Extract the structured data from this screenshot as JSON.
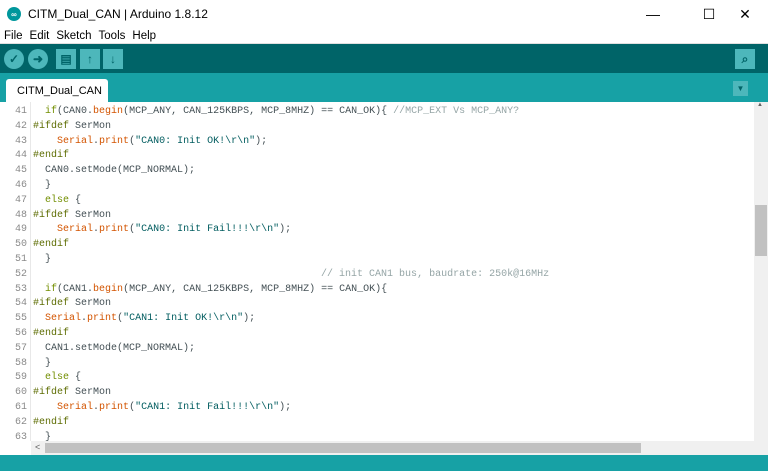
{
  "window": {
    "title": "CITM_Dual_CAN | Arduino 1.8.12",
    "minimize": "—",
    "maximize": "☐",
    "close": "✕"
  },
  "menu": [
    "File",
    "Edit",
    "Sketch",
    "Tools",
    "Help"
  ],
  "toolbar": {
    "verify": "✓",
    "upload": "➜",
    "new": "▤",
    "open": "↑",
    "save": "↓",
    "serial_monitor": "⌕"
  },
  "tabs": {
    "active": "CITM_Dual_CAN",
    "menu": "▼"
  },
  "colors": {
    "toolbar": "#006468",
    "tabbar": "#17A1A5",
    "keyword": "#728E00",
    "preprocessor": "#5E6D03",
    "function": "#D35400",
    "comment": "#95A5A6"
  },
  "code": [
    {
      "n": "41",
      "t": [
        [
          "n",
          "  "
        ],
        [
          "k",
          "if"
        ],
        [
          "n",
          "(CAN0."
        ],
        [
          "f",
          "begin"
        ],
        [
          "n",
          "(MCP_ANY, CAN_125KBPS, MCP_8MHZ) == CAN_OK){ "
        ],
        [
          "c",
          "//MCP_EXT Vs MCP_ANY?"
        ]
      ]
    },
    {
      "n": "42",
      "t": [
        [
          "p",
          "#ifdef"
        ],
        [
          "n",
          " SerMon"
        ]
      ]
    },
    {
      "n": "43",
      "t": [
        [
          "n",
          "    "
        ],
        [
          "f",
          "Serial"
        ],
        [
          "n",
          "."
        ],
        [
          "f",
          "print"
        ],
        [
          "n",
          "("
        ],
        [
          "s",
          "\"CAN0: Init OK!\\r\\n\""
        ],
        [
          "n",
          ");"
        ]
      ]
    },
    {
      "n": "44",
      "t": [
        [
          "p",
          "#endif"
        ]
      ]
    },
    {
      "n": "45",
      "t": [
        [
          "n",
          "  CAN0.setMode(MCP_NORMAL);"
        ]
      ]
    },
    {
      "n": "46",
      "t": [
        [
          "n",
          "  }"
        ]
      ]
    },
    {
      "n": "47",
      "t": [
        [
          "n",
          "  "
        ],
        [
          "k",
          "else"
        ],
        [
          "n",
          " {"
        ]
      ]
    },
    {
      "n": "48",
      "t": [
        [
          "p",
          "#ifdef"
        ],
        [
          "n",
          " SerMon"
        ]
      ]
    },
    {
      "n": "49",
      "t": [
        [
          "n",
          "    "
        ],
        [
          "f",
          "Serial"
        ],
        [
          "n",
          "."
        ],
        [
          "f",
          "print"
        ],
        [
          "n",
          "("
        ],
        [
          "s",
          "\"CAN0: Init Fail!!!\\r\\n\""
        ],
        [
          "n",
          ");"
        ]
      ]
    },
    {
      "n": "50",
      "t": [
        [
          "p",
          "#endif"
        ]
      ]
    },
    {
      "n": "51",
      "t": [
        [
          "n",
          "  }"
        ]
      ]
    },
    {
      "n": "52",
      "t": [
        [
          "n",
          "                                                "
        ],
        [
          "c",
          "// init CAN1 bus, baudrate: 250k@16MHz"
        ]
      ]
    },
    {
      "n": "53",
      "t": [
        [
          "n",
          "  "
        ],
        [
          "k",
          "if"
        ],
        [
          "n",
          "(CAN1."
        ],
        [
          "f",
          "begin"
        ],
        [
          "n",
          "(MCP_ANY, CAN_125KBPS, MCP_8MHZ) == CAN_OK){"
        ]
      ]
    },
    {
      "n": "54",
      "t": [
        [
          "p",
          "#ifdef"
        ],
        [
          "n",
          " SerMon"
        ]
      ]
    },
    {
      "n": "55",
      "t": [
        [
          "n",
          "  "
        ],
        [
          "f",
          "Serial"
        ],
        [
          "n",
          "."
        ],
        [
          "f",
          "print"
        ],
        [
          "n",
          "("
        ],
        [
          "s",
          "\"CAN1: Init OK!\\r\\n\""
        ],
        [
          "n",
          ");"
        ]
      ]
    },
    {
      "n": "56",
      "t": [
        [
          "p",
          "#endif"
        ]
      ]
    },
    {
      "n": "57",
      "t": [
        [
          "n",
          "  CAN1.setMode(MCP_NORMAL);"
        ]
      ]
    },
    {
      "n": "58",
      "t": [
        [
          "n",
          "  }"
        ]
      ]
    },
    {
      "n": "59",
      "t": [
        [
          "n",
          "  "
        ],
        [
          "k",
          "else"
        ],
        [
          "n",
          " {"
        ]
      ]
    },
    {
      "n": "60",
      "t": [
        [
          "p",
          "#ifdef"
        ],
        [
          "n",
          " SerMon"
        ]
      ]
    },
    {
      "n": "61",
      "t": [
        [
          "n",
          "    "
        ],
        [
          "f",
          "Serial"
        ],
        [
          "n",
          "."
        ],
        [
          "f",
          "print"
        ],
        [
          "n",
          "("
        ],
        [
          "s",
          "\"CAN1: Init Fail!!!\\r\\n\""
        ],
        [
          "n",
          ");"
        ]
      ]
    },
    {
      "n": "62",
      "t": [
        [
          "p",
          "#endif"
        ]
      ]
    },
    {
      "n": "63",
      "t": [
        [
          "n",
          "  }"
        ]
      ]
    }
  ],
  "scroll": {
    "left_arrow": "<",
    "up_arrow": "▲",
    "vertical_position_percent": 35
  }
}
